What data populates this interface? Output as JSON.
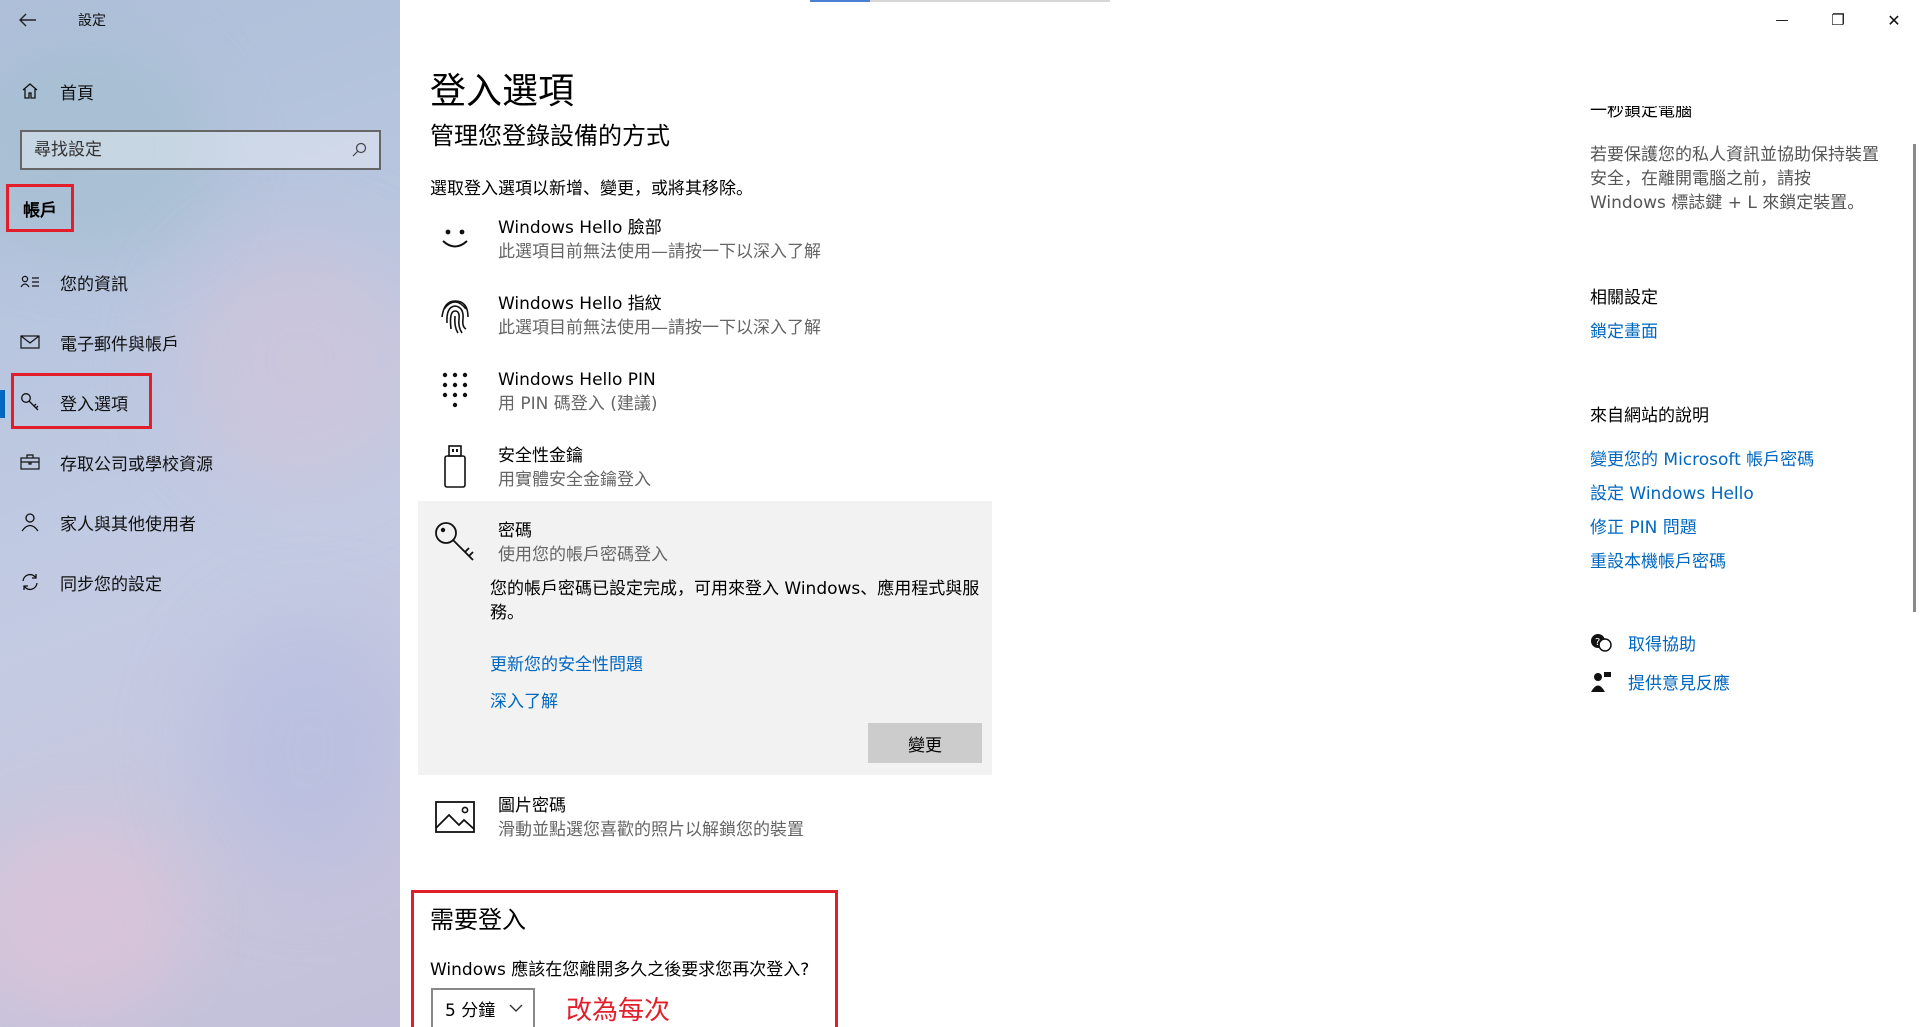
{
  "window": {
    "title": "設定",
    "back_glyph": "←",
    "minimize_glyph": "—",
    "maximize_glyph": "❐",
    "close_glyph": "✕"
  },
  "sidebar": {
    "home_label": "首頁",
    "search_placeholder": "尋找設定",
    "section_header": "帳戶",
    "items": [
      {
        "label": "您的資訊",
        "icon": "contact-info-icon"
      },
      {
        "label": "電子郵件與帳戶",
        "icon": "mail-icon"
      },
      {
        "label": "登入選項",
        "icon": "key-icon",
        "active": true
      },
      {
        "label": "存取公司或學校資源",
        "icon": "briefcase-icon"
      },
      {
        "label": "家人與其他使用者",
        "icon": "person-icon"
      },
      {
        "label": "同步您的設定",
        "icon": "sync-icon"
      }
    ]
  },
  "main": {
    "title": "登入選項",
    "subtitle": "管理您登錄設備的方式",
    "intro": "選取登入選項以新增、變更，或將其移除。",
    "options": [
      {
        "title": "Windows Hello 臉部",
        "sub": "此選項目前無法使用—請按一下以深入了解",
        "icon": "face-icon"
      },
      {
        "title": "Windows Hello 指紋",
        "sub": "此選項目前無法使用—請按一下以深入了解",
        "icon": "fingerprint-icon"
      },
      {
        "title": "Windows Hello PIN",
        "sub": "用 PIN 碼登入 (建議)",
        "icon": "pin-keypad-icon"
      },
      {
        "title": "安全性金鑰",
        "sub": "用實體安全金鑰登入",
        "icon": "usb-key-icon"
      }
    ],
    "password": {
      "title": "密碼",
      "sub": "使用您的帳戶密碼登入",
      "description": "您的帳戶密碼已設定完成，可用來登入 Windows、應用程式與服務。",
      "link_security": "更新您的安全性問題",
      "link_learn": "深入了解",
      "change_button": "變更"
    },
    "picture_password": {
      "title": "圖片密碼",
      "sub": "滑動並點選您喜歡的照片以解鎖您的裝置"
    },
    "require_signin": {
      "title": "需要登入",
      "question": "Windows 應該在您離開多久之後要求您再次登入?",
      "selected": "5 分鐘",
      "annotation": "改為每次"
    }
  },
  "right": {
    "cut_title": "一秒鎖定電腦",
    "lock_description": "若要保護您的私人資訊並協助保持裝置安全，在離開電腦之前，請按 Windows 標誌鍵 + L 來鎖定裝置。",
    "related_heading": "相關設定",
    "related_link": "鎖定畫面",
    "web_help_heading": "來自網站的說明",
    "web_links": [
      "變更您的 Microsoft 帳戶密碼",
      "設定 Windows Hello",
      "修正 PIN 問題",
      "重設本機帳戶密碼"
    ],
    "get_help": "取得協助",
    "feedback": "提供意見反應"
  },
  "colors": {
    "accent": "#0067c0",
    "highlight_red": "#e31e2b"
  }
}
